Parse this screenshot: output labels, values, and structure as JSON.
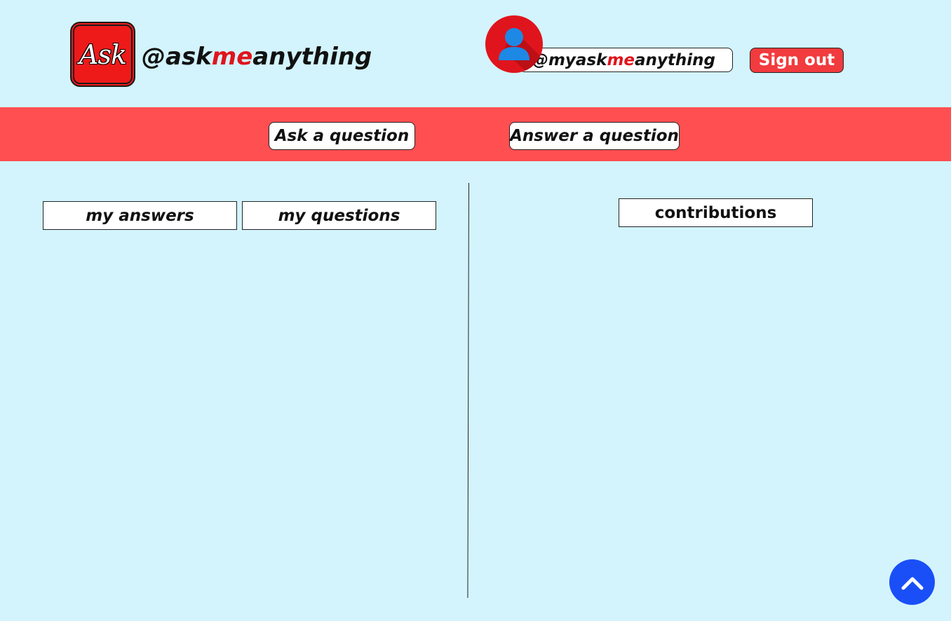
{
  "brand": {
    "logo_text": "Ask",
    "handle_prefix": "@ask",
    "handle_accent": "me",
    "handle_suffix": "anything"
  },
  "user": {
    "handle_prefix": "@myask",
    "handle_accent": "me",
    "handle_suffix": "anything",
    "avatar_icon": "user-avatar-icon"
  },
  "header": {
    "sign_out_label": "Sign out"
  },
  "nav": {
    "ask_label": "Ask a question",
    "answer_label": "Answer a question"
  },
  "left_panel": {
    "tabs": [
      {
        "label": "my answers"
      },
      {
        "label": "my questions"
      }
    ]
  },
  "right_panel": {
    "tab_label": "contributions"
  },
  "scroll_top": {
    "icon": "chevron-up-icon"
  },
  "colors": {
    "background": "#d3f4fd",
    "navbar": "#ff4f51",
    "accent_red": "#e0141c",
    "sign_out_bg": "#f13b3e",
    "scroll_button": "#1a4ff7",
    "avatar_figure": "#1e88e5"
  }
}
